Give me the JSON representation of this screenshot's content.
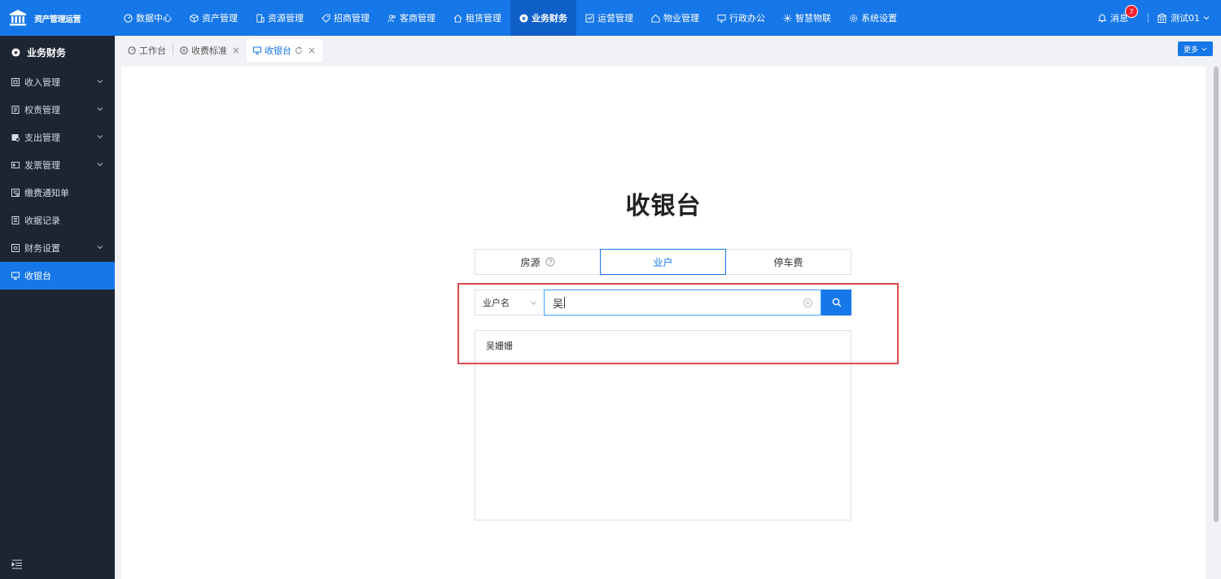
{
  "brand": {
    "name": "资产管理运营"
  },
  "nav": [
    {
      "label": "数据中心",
      "icon": "dashboard-icon"
    },
    {
      "label": "资产管理",
      "icon": "cube-icon"
    },
    {
      "label": "资源管理",
      "icon": "building-icon"
    },
    {
      "label": "招商管理",
      "icon": "tag-icon"
    },
    {
      "label": "客商管理",
      "icon": "users-icon"
    },
    {
      "label": "租赁管理",
      "icon": "home-icon"
    },
    {
      "label": "业务财务",
      "icon": "finance-icon",
      "active": true
    },
    {
      "label": "运营管理",
      "icon": "chart-icon"
    },
    {
      "label": "物业管理",
      "icon": "house-icon"
    },
    {
      "label": "行政办公",
      "icon": "monitor-icon"
    },
    {
      "label": "智慧物联",
      "icon": "iot-icon"
    },
    {
      "label": "系统设置",
      "icon": "gear-icon"
    }
  ],
  "header": {
    "messages_label": "消息",
    "messages_count": "7",
    "user_label": "测试01"
  },
  "sidebar": {
    "title": "业务财务",
    "items": [
      {
        "label": "收入管理",
        "has_children": true
      },
      {
        "label": "权责管理",
        "has_children": true
      },
      {
        "label": "支出管理",
        "has_children": true
      },
      {
        "label": "发票管理",
        "has_children": true
      },
      {
        "label": "缴费通知单",
        "has_children": false
      },
      {
        "label": "收据记录",
        "has_children": false
      },
      {
        "label": "财务设置",
        "has_children": true
      },
      {
        "label": "收银台",
        "has_children": false,
        "active": true
      }
    ]
  },
  "tabs": {
    "items": [
      {
        "label": "工作台"
      },
      {
        "label": "收费标准"
      },
      {
        "label": "收银台"
      }
    ],
    "more_label": "更多"
  },
  "main": {
    "title": "收银台",
    "segments": [
      {
        "label": "房源"
      },
      {
        "label": "业户"
      },
      {
        "label": "停车费"
      }
    ],
    "search": {
      "field_select": "业户名",
      "value": "吴"
    },
    "results": [
      {
        "label": "吴姗姗"
      }
    ]
  },
  "colors": {
    "primary": "#1677e8",
    "sidebar_bg": "#1d2533",
    "highlight": "#e04b4b"
  }
}
